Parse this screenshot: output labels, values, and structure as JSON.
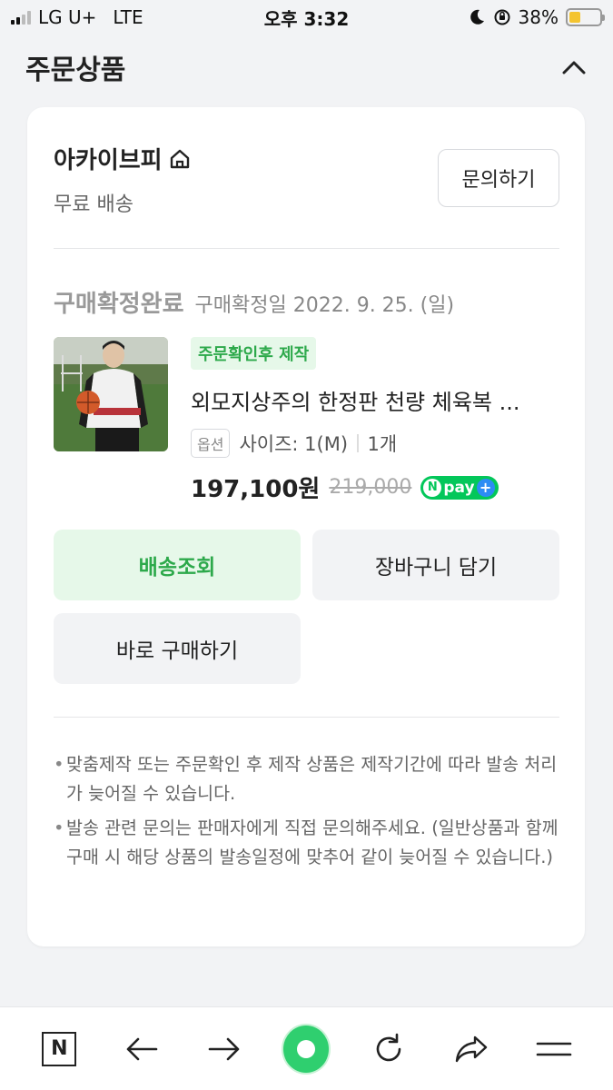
{
  "status_bar": {
    "carrier": "LG U+",
    "network": "LTE",
    "time": "오후 3:32",
    "battery": "38%"
  },
  "section": {
    "title": "주문상품"
  },
  "store": {
    "name": "아카이브피",
    "shipping": "무료 배송",
    "inquiry_label": "문의하기"
  },
  "order": {
    "status": "구매확정완료",
    "date": "구매확정일 2022. 9. 25. (일)",
    "badge": "주문확인후 제작",
    "product_name": "외모지상주의 한정판 천량 체육복 ...",
    "option_tag": "옵션",
    "option_value": "사이즈: 1(M)",
    "quantity": "1개",
    "price": "197,100원",
    "original_price": "219,000",
    "npay_label": "pay"
  },
  "buttons": {
    "track": "배송조회",
    "cart": "장바구니 담기",
    "buy_now": "바로 구매하기"
  },
  "notes": [
    "맞춤제작 또는 주문확인 후 제작 상품은 제작기간에 따라 발송 처리가 늦어질 수 있습니다.",
    "발송 관련 문의는 판매자에게 직접 문의해주세요. (일반상품과 함께 구매 시 해당 상품의 발송일정에 맞추어 같이 늦어질 수 있습니다.)"
  ],
  "colors": {
    "accent_green": "#2da94b",
    "badge_bg": "#e6f8e9",
    "npay_green": "#03c75a",
    "page_bg": "#f2f3f5"
  },
  "icons": {
    "store_home": "home-icon",
    "collapse": "chevron-up-icon"
  }
}
